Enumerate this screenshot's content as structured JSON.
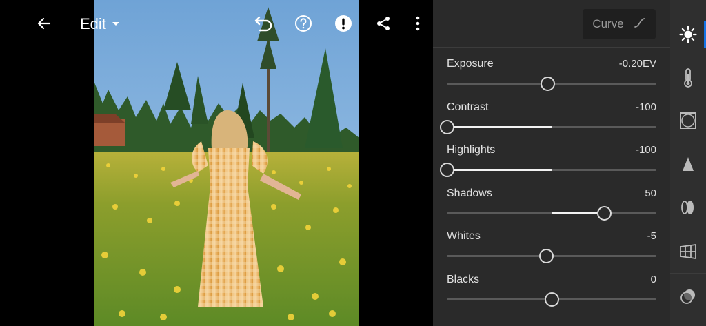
{
  "toolbar": {
    "edit_label": "Edit",
    "icons": {
      "back": "arrow-left-icon",
      "dropdown": "chevron-down-icon",
      "undo": "undo-icon",
      "help": "help-circle-icon",
      "alert": "alert-circle-icon",
      "share": "share-icon",
      "more": "more-vertical-icon"
    }
  },
  "panel": {
    "curve_label": "Curve",
    "sliders": [
      {
        "label": "Exposure",
        "value_text": "-0.20EV",
        "position": 0.48
      },
      {
        "label": "Contrast",
        "value_text": "-100",
        "position": 0.0
      },
      {
        "label": "Highlights",
        "value_text": "-100",
        "position": 0.0
      },
      {
        "label": "Shadows",
        "value_text": "50",
        "position": 0.75
      },
      {
        "label": "Whites",
        "value_text": "-5",
        "position": 0.475
      },
      {
        "label": "Blacks",
        "value_text": "0",
        "position": 0.5
      }
    ]
  },
  "rail": {
    "tools": [
      "light-icon",
      "color-icon",
      "effects-icon",
      "detail-icon",
      "optics-icon",
      "geometry-icon",
      "selective-icon"
    ],
    "active_tool": "light-icon",
    "accent": "#1473e6"
  },
  "photo": {
    "subject": "woman-in-gingham-dress-in-flower-field-image"
  }
}
